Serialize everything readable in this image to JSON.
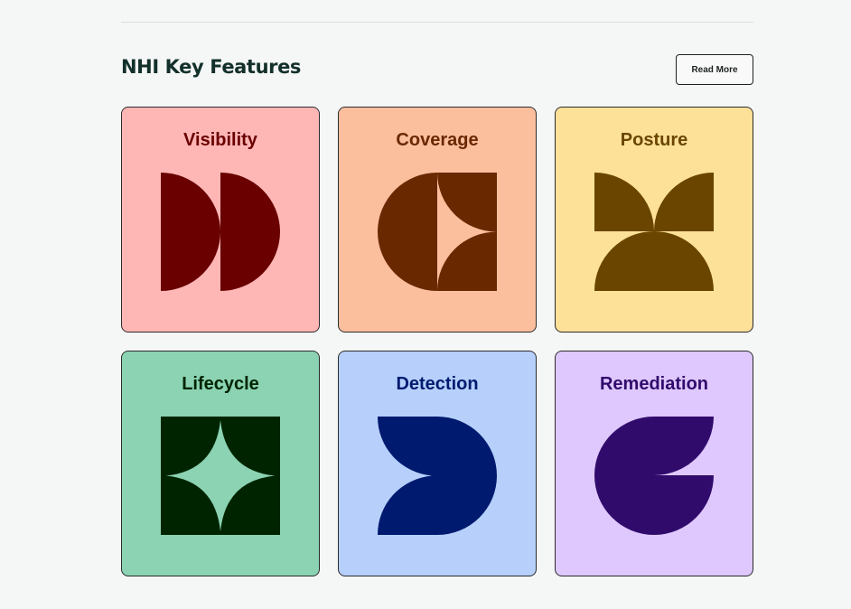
{
  "section": {
    "title": "NHI Key Features",
    "read_more_label": "Read More"
  },
  "cards": [
    {
      "title": "Visibility",
      "icon": "visibility-icon",
      "bg": "#ffb7b6",
      "fg": "#6a0000"
    },
    {
      "title": "Coverage",
      "icon": "coverage-icon",
      "bg": "#fbbf9e",
      "fg": "#6a2800"
    },
    {
      "title": "Posture",
      "icon": "posture-icon",
      "bg": "#fde199",
      "fg": "#6a4500"
    },
    {
      "title": "Lifecycle",
      "icon": "lifecycle-icon",
      "bg": "#8bd3b2",
      "fg": "#002400"
    },
    {
      "title": "Detection",
      "icon": "detection-icon",
      "bg": "#b6d0fb",
      "fg": "#001a70"
    },
    {
      "title": "Remediation",
      "icon": "remediation-icon",
      "bg": "#dec8fd",
      "fg": "#310b6c"
    }
  ]
}
